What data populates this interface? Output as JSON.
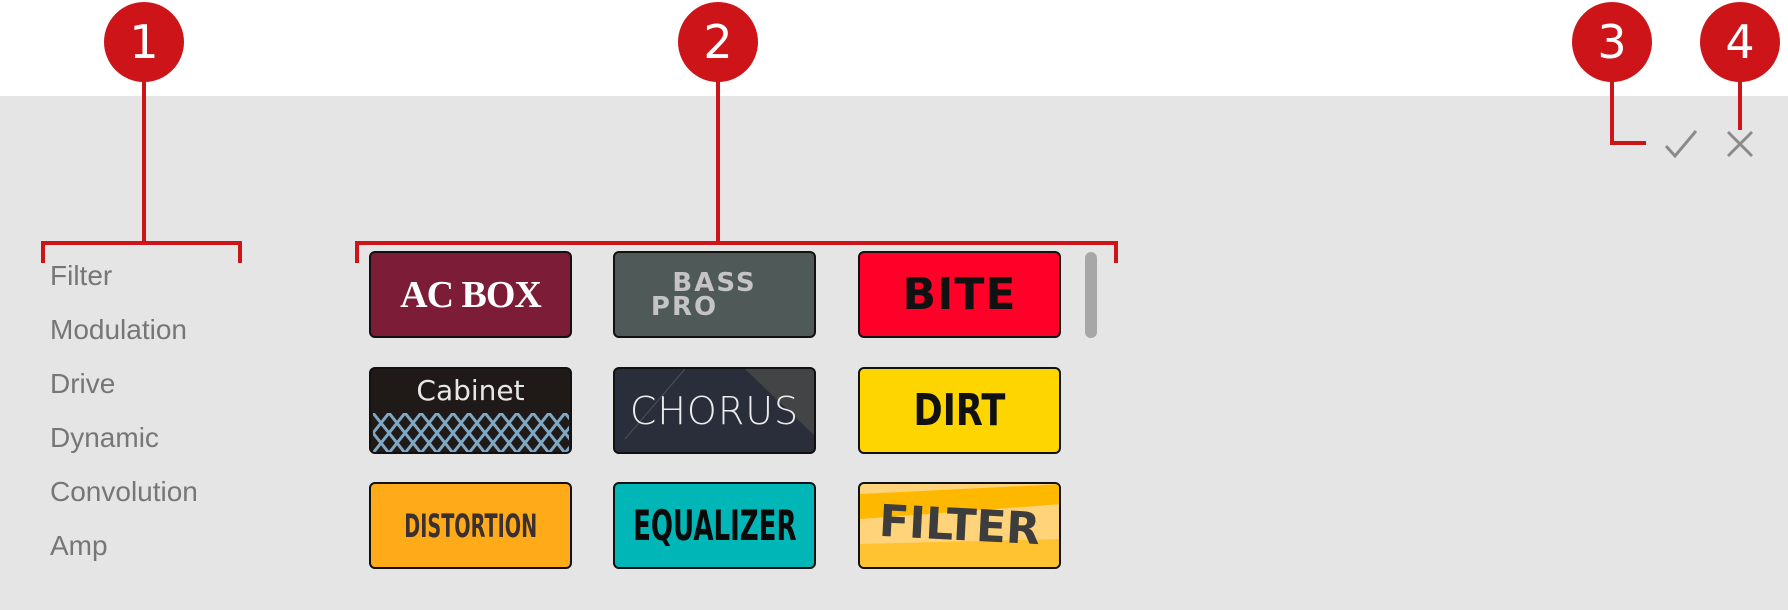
{
  "callouts": [
    "1",
    "2",
    "3",
    "4"
  ],
  "categories": [
    "Filter",
    "Modulation",
    "Drive",
    "Dynamic",
    "Convolution",
    "Amp"
  ],
  "tiles": [
    {
      "label": "AC BOX",
      "bg": "#7d1c36",
      "fg": "#ffffff"
    },
    {
      "label": "BASS",
      "label2": "PRO",
      "bg": "#4f5958",
      "fg": "#c4c4c4"
    },
    {
      "label": "BITE",
      "bg": "#ff0028",
      "fg": "#111111"
    },
    {
      "label": "Cabinet",
      "bg": "#1f1a18",
      "fg": "#e6e6e6",
      "pattern": "#7fa7c4"
    },
    {
      "label": "CHORUS",
      "bg": "#2a2e3b",
      "fg": "#ececec"
    },
    {
      "label": "DIRT",
      "bg": "#ffd500",
      "fg": "#111111"
    },
    {
      "label": "DISTORTION",
      "bg": "#ffaa18",
      "fg": "#3a3030"
    },
    {
      "label": "EQUALIZER",
      "bg": "#00b6b6",
      "fg": "#0a0a0a"
    },
    {
      "label": "FILTER",
      "bg": "#ffd37a",
      "fg": "#3d3d3d",
      "stripe": "#ffb800"
    }
  ],
  "actions": {
    "confirm": "confirm",
    "cancel": "cancel"
  },
  "colors": {
    "accent": "#cc1419",
    "panel": "#e5e5e5",
    "icon": "#8a8a8a"
  }
}
